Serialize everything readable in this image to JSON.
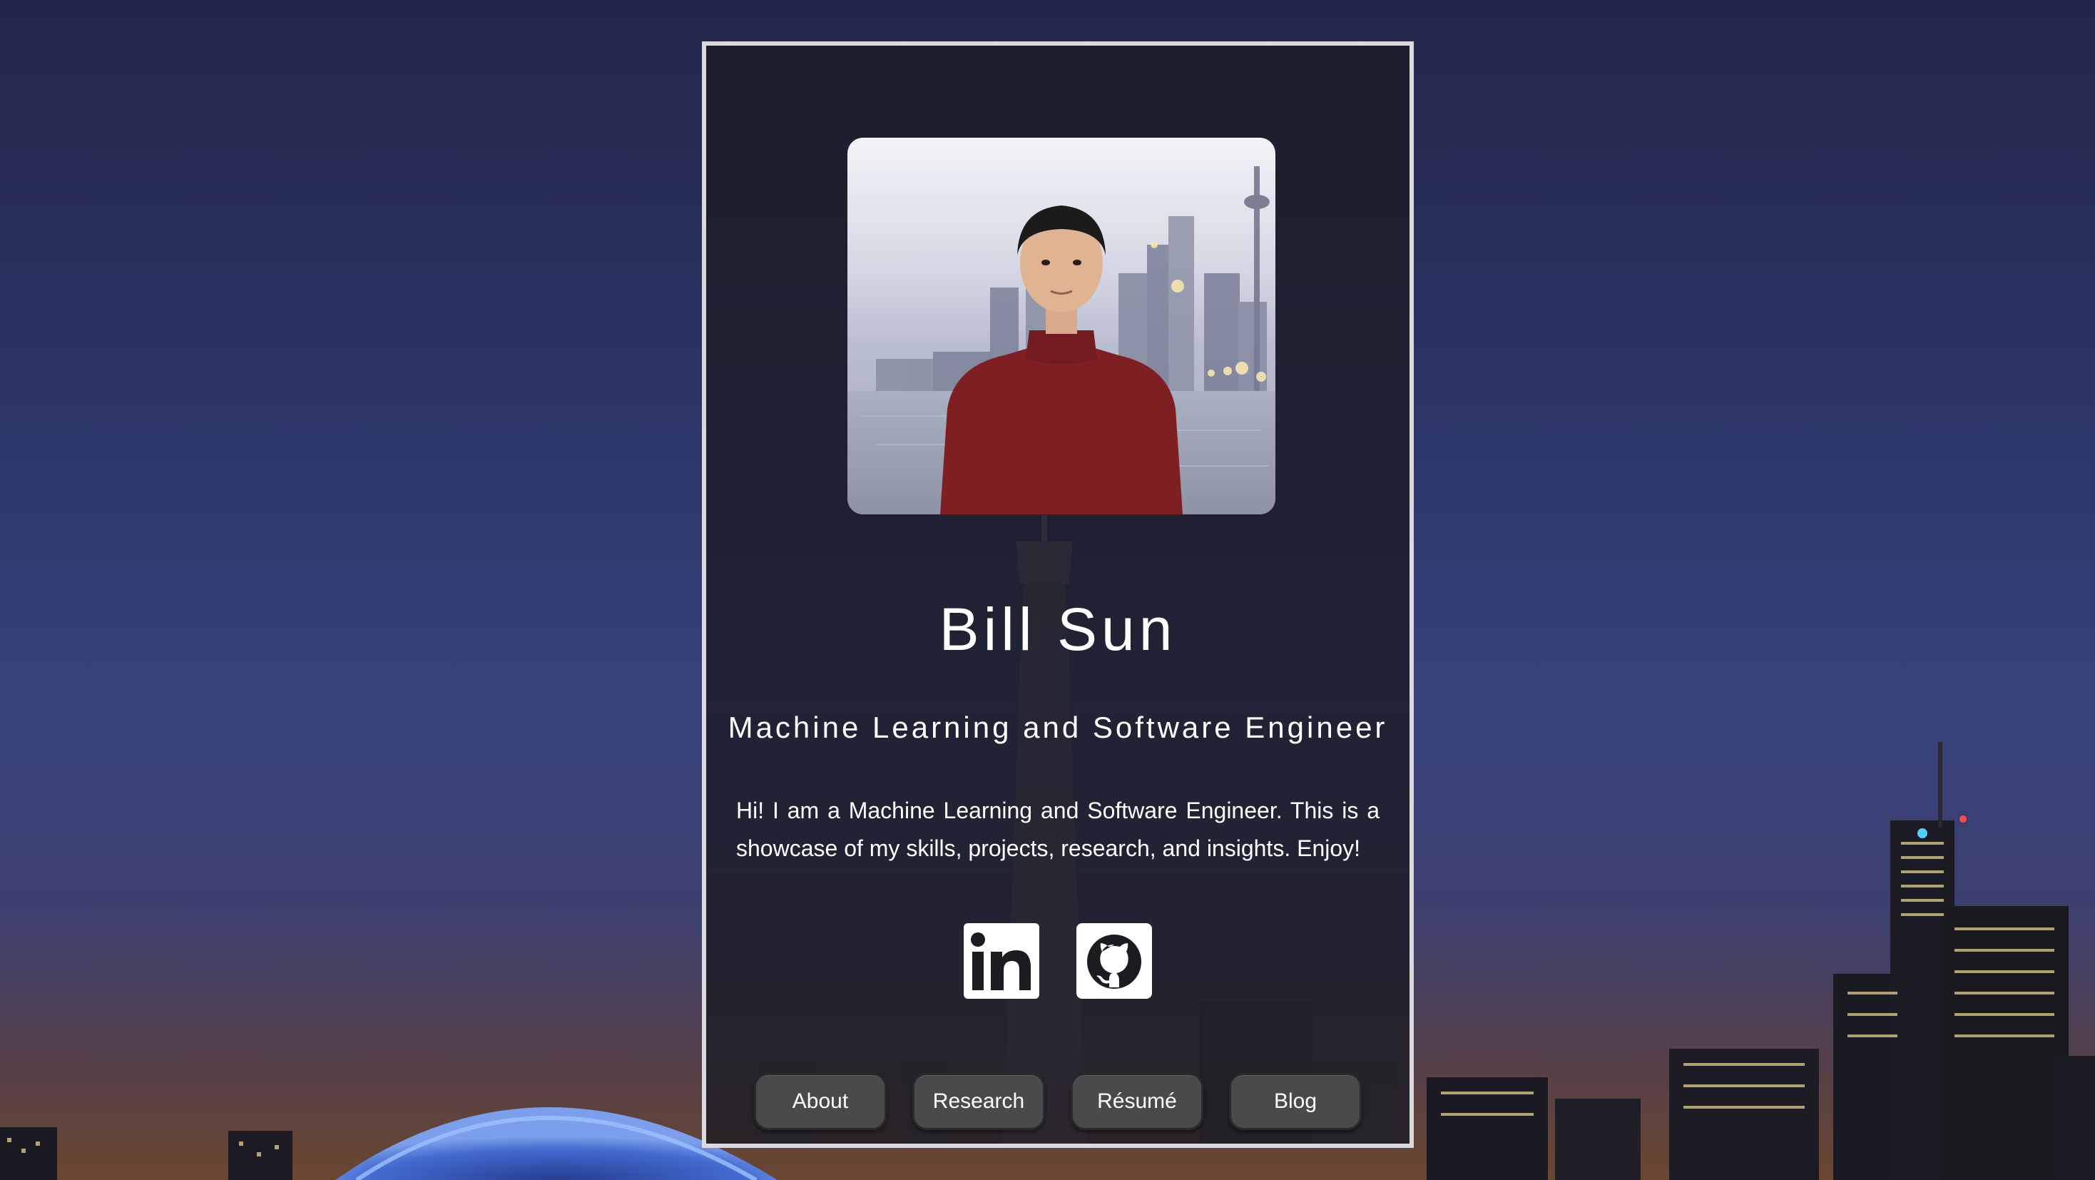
{
  "profile": {
    "name": "Bill Sun",
    "tagline": "Machine Learning and Software Engineer",
    "bio": "Hi! I am a Machine Learning and Software Engineer. This is a showcase of my skills, projects, research, and insights. Enjoy!"
  },
  "socials": [
    {
      "icon": "linkedin-icon",
      "label": "LinkedIn"
    },
    {
      "icon": "github-icon",
      "label": "GitHub"
    }
  ],
  "nav": {
    "about": "About",
    "research": "Research",
    "resume": "Résumé",
    "blog": "Blog"
  },
  "colors": {
    "card_border": "#d9d9de",
    "button_bg": "#4a4a4c",
    "sky_top": "#23264a",
    "sky_mid": "#34407a"
  }
}
